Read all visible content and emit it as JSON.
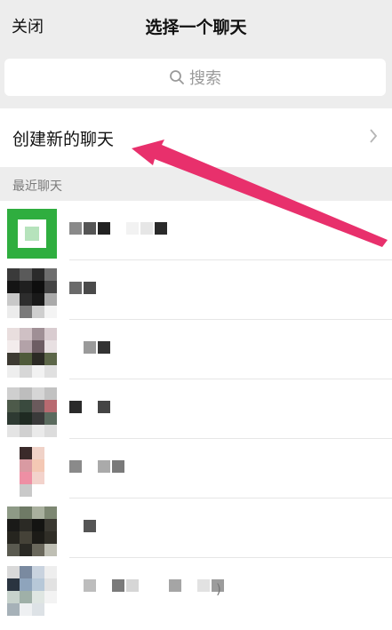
{
  "header": {
    "close_label": "关闭",
    "title": "选择一个聊天"
  },
  "search": {
    "placeholder": "搜索"
  },
  "new_chat": {
    "label": "创建新的聊天"
  },
  "recent": {
    "section_label": "最近聊天",
    "trailing_paren": ")"
  },
  "colors": {
    "header_bg": "#ededed",
    "annotation_arrow": "#e8306c",
    "avatar_green": "#2fae3f"
  },
  "icons": {
    "search": "magnifier-icon",
    "chevron": "chevron-right-icon",
    "annotation": "pointer-arrow"
  }
}
